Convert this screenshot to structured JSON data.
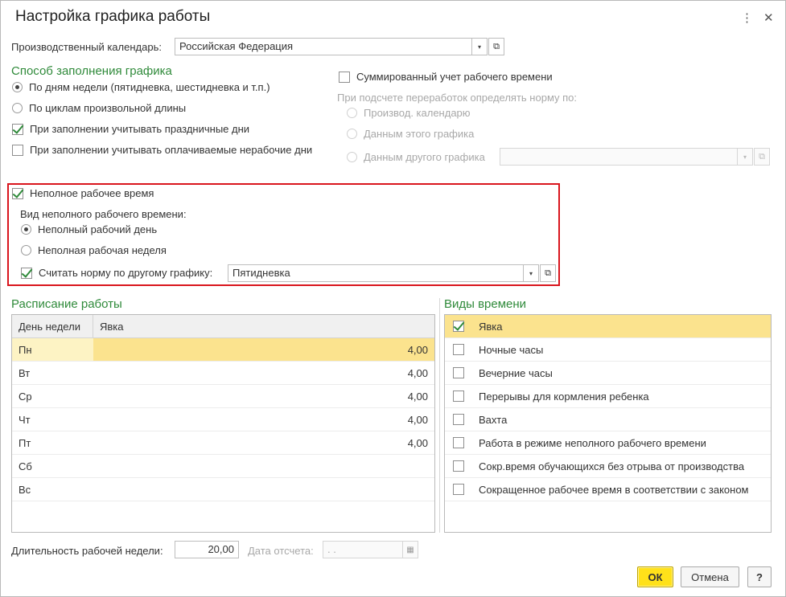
{
  "window": {
    "title": "Настройка графика работы",
    "icons": [
      "kebab-menu-icon",
      "close-icon"
    ],
    "menu_glyph": "⋮",
    "close_glyph": "✕"
  },
  "calendar": {
    "label": "Производственный календарь:",
    "value": "Российская Федерация",
    "dropdown_glyph": "▾",
    "open_glyph": "⧉"
  },
  "fill_method": {
    "title": "Способ заполнения графика",
    "options": [
      {
        "label": "По дням недели (пятидневка, шестидневка и т.п.)",
        "selected": true
      },
      {
        "label": "По циклам произвольной длины",
        "selected": false
      }
    ],
    "holidays": {
      "label": "При заполнении учитывать праздничные дни",
      "checked": true
    },
    "paid_nonwork": {
      "label": "При заполнении учитывать оплачиваемые нерабочие дни",
      "checked": false
    }
  },
  "summary_accounting": {
    "label": "Суммированный учет рабочего времени",
    "checked": false,
    "norm_label": "При подсчете переработок определять норму по:",
    "options": [
      {
        "label": "Производ. календарю"
      },
      {
        "label": "Данным этого графика"
      },
      {
        "label": "Данным другого графика"
      }
    ]
  },
  "part_time": {
    "label": "Неполное рабочее время",
    "checked": true,
    "kind_label": "Вид неполного рабочего времени:",
    "options": [
      {
        "label": "Неполный рабочий день",
        "selected": true
      },
      {
        "label": "Неполная рабочая неделя",
        "selected": false
      }
    ],
    "norm_other": {
      "label": "Считать норму по другому графику:",
      "checked": true,
      "value": "Пятидневка"
    }
  },
  "schedule": {
    "title": "Расписание работы",
    "columns": [
      "День недели",
      "Явка"
    ],
    "rows": [
      {
        "day": "Пн",
        "value": "4,00"
      },
      {
        "day": "Вт",
        "value": "4,00"
      },
      {
        "day": "Ср",
        "value": "4,00"
      },
      {
        "day": "Чт",
        "value": "4,00"
      },
      {
        "day": "Пт",
        "value": "4,00"
      },
      {
        "day": "Сб",
        "value": ""
      },
      {
        "day": "Вс",
        "value": ""
      }
    ],
    "selected_row_index": 0
  },
  "time_types": {
    "title": "Виды времени",
    "items": [
      {
        "label": "Явка",
        "checked": true
      },
      {
        "label": "Ночные часы",
        "checked": false
      },
      {
        "label": "Вечерние часы",
        "checked": false
      },
      {
        "label": "Перерывы для кормления ребенка",
        "checked": false
      },
      {
        "label": "Вахта",
        "checked": false
      },
      {
        "label": "Работа в режиме неполного рабочего времени",
        "checked": false
      },
      {
        "label": "Сокр.время обучающихся без отрыва от производства",
        "checked": false
      },
      {
        "label": "Сокращенное рабочее время в соответствии с законом",
        "checked": false
      }
    ],
    "selected_index": 0
  },
  "footer": {
    "week_length_label": "Длительность рабочей недели:",
    "week_length_value": "20,00",
    "report_date_label": "Дата отсчета:",
    "report_date_value": " .  .",
    "calendar_glyph": "▦"
  },
  "buttons": {
    "ok": "ОК",
    "cancel": "Отмена",
    "help": "?"
  },
  "colors": {
    "accent_green": "#2f8a3a",
    "highlight_red": "#d9151d",
    "selection_yellow": "#fbe38e",
    "ok_yellow": "#ffe11a"
  }
}
